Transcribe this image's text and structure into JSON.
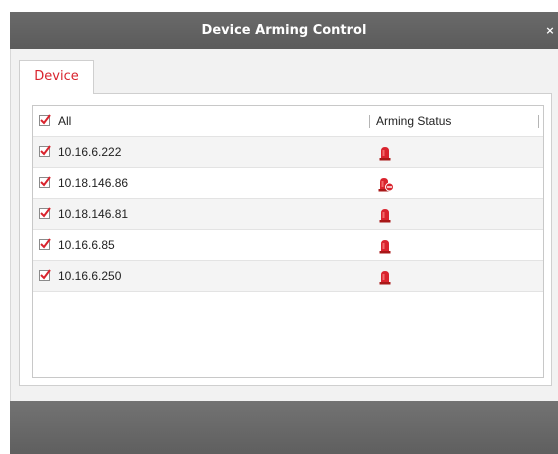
{
  "dialog": {
    "title": "Device Arming Control",
    "close_label": "×"
  },
  "tabs": [
    {
      "label": "Device",
      "active": true
    }
  ],
  "table": {
    "select_all_label": "All",
    "select_all_checked": true,
    "status_header": "Arming Status",
    "rows": [
      {
        "ip": "10.16.6.222",
        "checked": true,
        "status_icon": "alarm-light-armed-icon"
      },
      {
        "ip": "10.18.146.86",
        "checked": true,
        "status_icon": "alarm-light-disarmed-icon"
      },
      {
        "ip": "10.18.146.81",
        "checked": true,
        "status_icon": "alarm-light-armed-icon"
      },
      {
        "ip": "10.16.6.85",
        "checked": true,
        "status_icon": "alarm-light-armed-icon"
      },
      {
        "ip": "10.16.6.250",
        "checked": true,
        "status_icon": "alarm-light-armed-icon"
      }
    ]
  },
  "colors": {
    "accent_red": "#d9232d",
    "titlebar": "#5f5f5f"
  }
}
